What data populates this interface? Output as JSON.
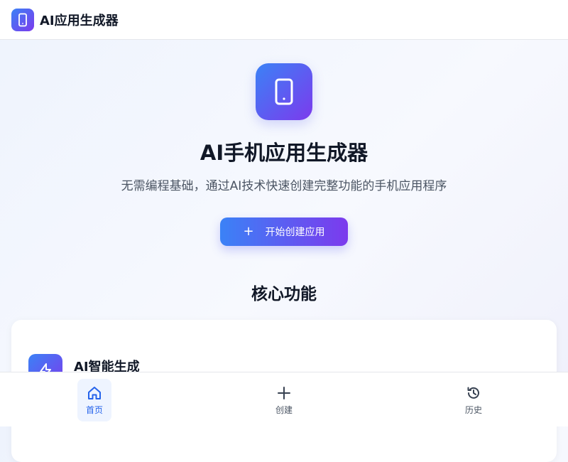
{
  "header": {
    "title": "AI应用生成器",
    "logo_icon": "phone-icon"
  },
  "hero": {
    "icon": "phone-icon",
    "title": "AI手机应用生成器",
    "subtitle": "无需编程基础，通过AI技术快速创建完整功能的手机应用程序",
    "cta_icon": "plus-icon",
    "cta_label": "开始创建应用"
  },
  "features": {
    "section_title": "核心功能",
    "items": [
      {
        "icon": "lightning-icon",
        "title": "AI智能生成"
      }
    ]
  },
  "bottom_nav": {
    "items": [
      {
        "icon": "home-icon",
        "label": "首页",
        "active": true
      },
      {
        "icon": "plus-icon",
        "label": "创建",
        "active": false
      },
      {
        "icon": "history-icon",
        "label": "历史",
        "active": false
      }
    ]
  },
  "colors": {
    "accent_start": "#3b82f6",
    "accent_end": "#7c3aed",
    "active_nav": "#2563eb"
  }
}
